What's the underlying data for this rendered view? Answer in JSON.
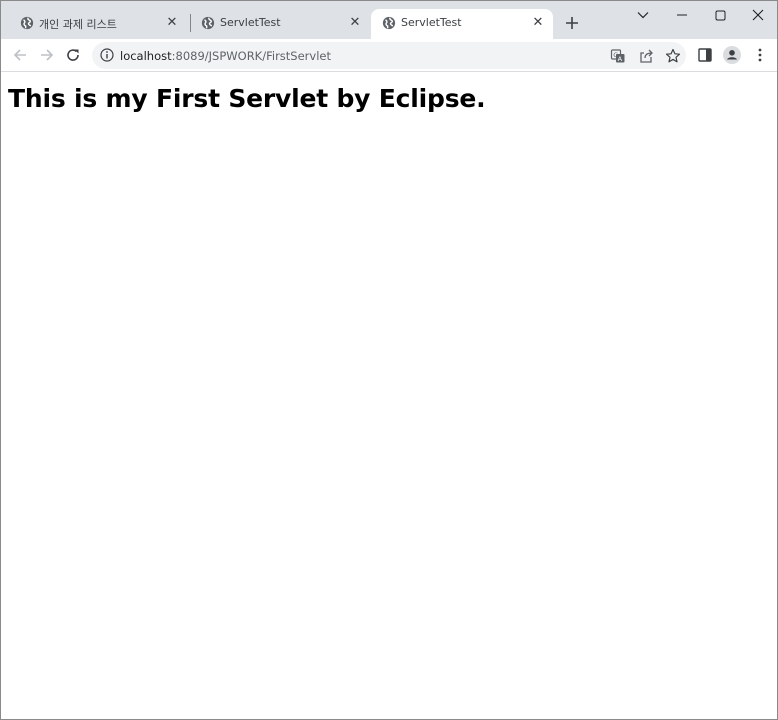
{
  "browser": {
    "tabs": [
      {
        "title": "개인 과제 리스트",
        "active": false,
        "icon": "globe-icon",
        "close": "✕"
      },
      {
        "title": "ServletTest",
        "active": false,
        "icon": "globe-icon",
        "close": "✕"
      },
      {
        "title": "ServletTest",
        "active": true,
        "icon": "globe-icon",
        "close": "✕"
      }
    ],
    "new_tab": "+",
    "address": {
      "host": "localhost",
      "path": ":8089/JSPWORK/FirstServlet"
    }
  },
  "page": {
    "heading": "This is my First Servlet by Eclipse."
  }
}
